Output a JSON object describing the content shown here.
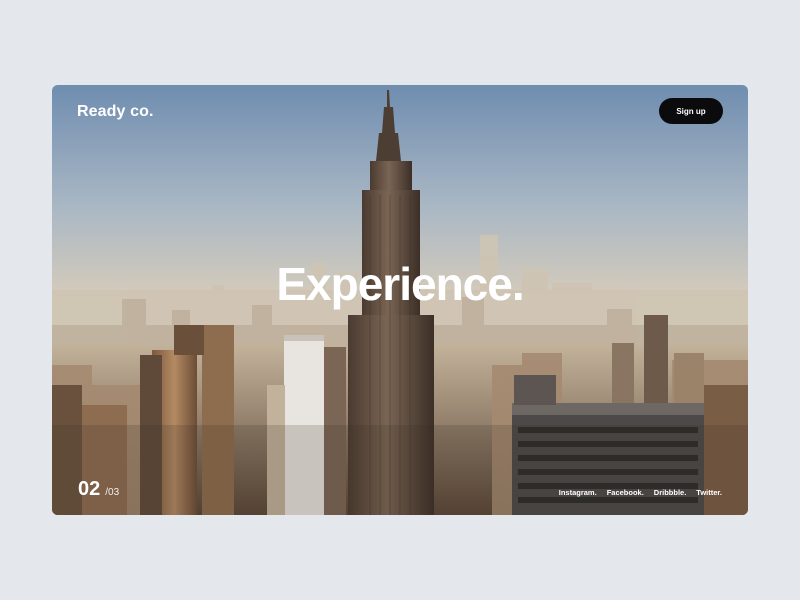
{
  "header": {
    "logo": "Ready co.",
    "signup_label": "Sign up"
  },
  "hero": {
    "title": "Experience.",
    "image": "city-skyline-photo"
  },
  "pager": {
    "current": "02",
    "total": "/03"
  },
  "social_links": [
    "Instagram.",
    "Facebook.",
    "Dribbble.",
    "Twitter."
  ],
  "colors": {
    "page_background": "#e4e7ec",
    "button_background": "#0b0b0d",
    "text": "#ffffff"
  }
}
